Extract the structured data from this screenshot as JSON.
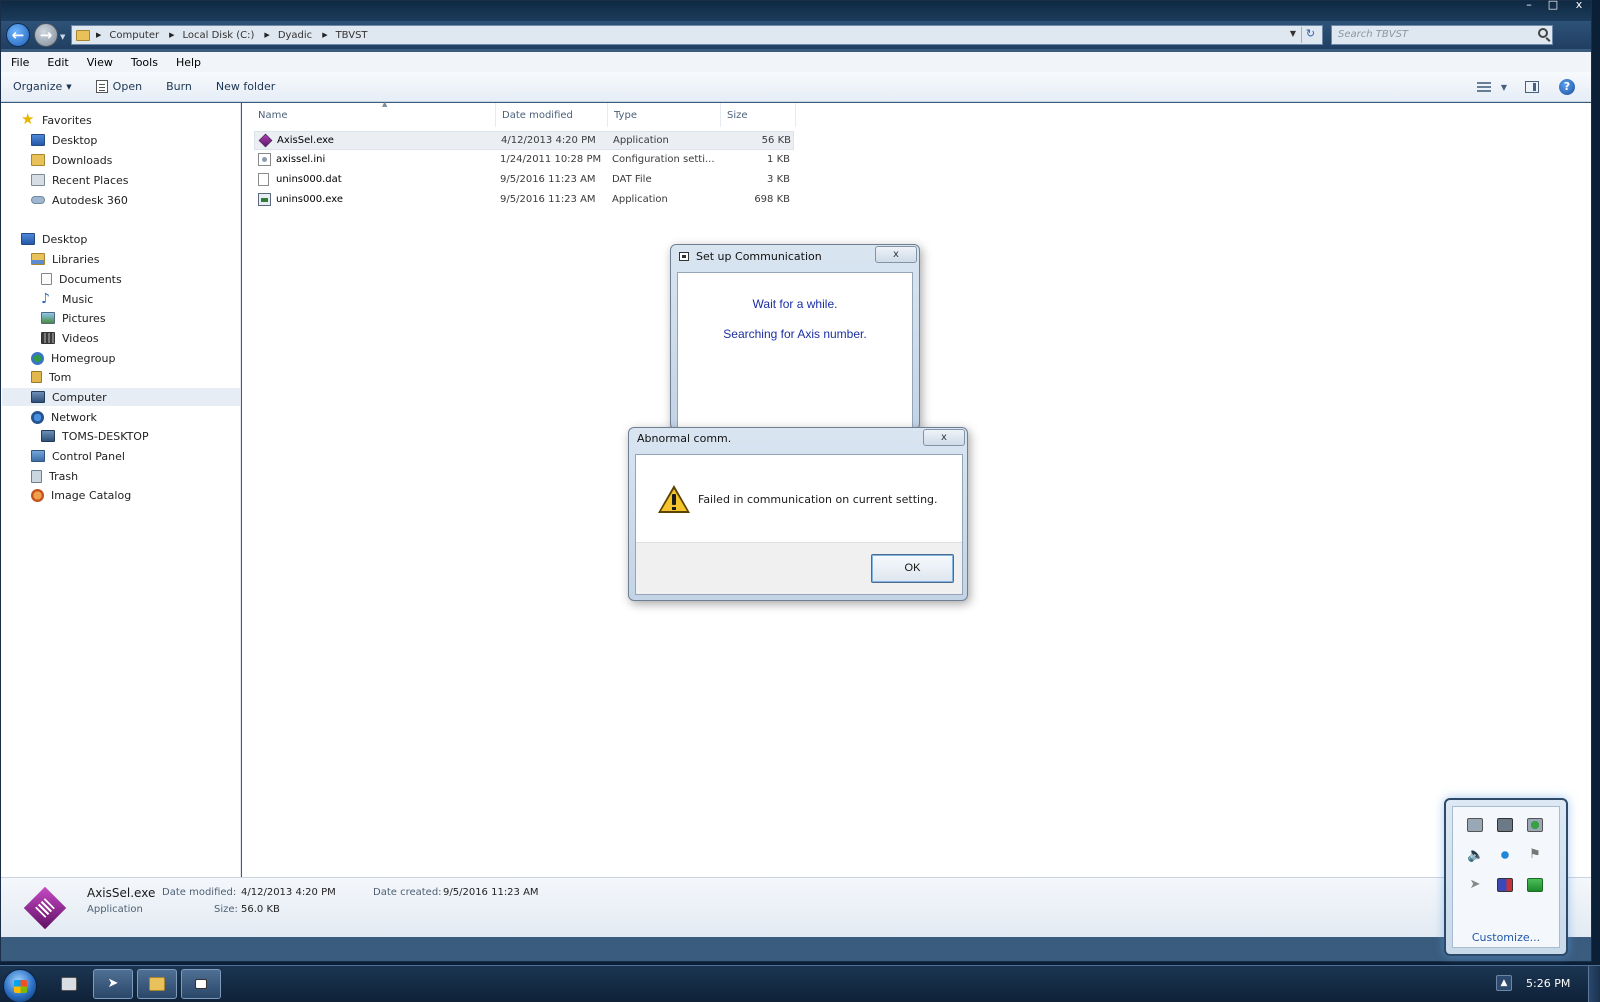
{
  "window": {
    "controls": [
      "–",
      "□",
      "x"
    ]
  },
  "address": {
    "crumbs": [
      "Computer",
      "Local Disk (C:)",
      "Dyadic",
      "TBVST"
    ],
    "search_placeholder": "Search TBVST"
  },
  "menu": [
    "File",
    "Edit",
    "View",
    "Tools",
    "Help"
  ],
  "toolbar": {
    "organize": "Organize",
    "open": "Open",
    "burn": "Burn",
    "new_folder": "New folder"
  },
  "nav": {
    "favorites": "Favorites",
    "desktop_fav": "Desktop",
    "downloads": "Downloads",
    "recent": "Recent Places",
    "autodesk": "Autodesk 360",
    "desktop": "Desktop",
    "libraries": "Libraries",
    "documents": "Documents",
    "music": "Music",
    "pictures": "Pictures",
    "videos": "Videos",
    "homegroup": "Homegroup",
    "tom": "Tom",
    "computer": "Computer",
    "network": "Network",
    "toms_desktop": "TOMS-DESKTOP",
    "control_panel": "Control Panel",
    "trash": "Trash",
    "image_catalog": "Image Catalog"
  },
  "columns": {
    "name": "Name",
    "date": "Date modified",
    "type": "Type",
    "size": "Size"
  },
  "files": [
    {
      "name": "AxisSel.exe",
      "date": "4/12/2013 4:20 PM",
      "type": "Application",
      "size": "56 KB"
    },
    {
      "name": "axissel.ini",
      "date": "1/24/2011 10:28 PM",
      "type": "Configuration setti...",
      "size": "1 KB"
    },
    {
      "name": "unins000.dat",
      "date": "9/5/2016 11:23 AM",
      "type": "DAT File",
      "size": "3 KB"
    },
    {
      "name": "unins000.exe",
      "date": "9/5/2016 11:23 AM",
      "type": "Application",
      "size": "698 KB"
    }
  ],
  "details": {
    "name": "AxisSel.exe",
    "type": "Application",
    "date_modified_label": "Date modified:",
    "date_modified": "4/12/2013 4:20 PM",
    "date_created_label": "Date created:",
    "date_created": "9/5/2016 11:23 AM",
    "size_label": "Size:",
    "size": "56.0 KB"
  },
  "setup_dialog": {
    "title": "Set up Communication",
    "close": "x",
    "line1": "Wait for a while.",
    "line2": "Searching for Axis number."
  },
  "abnormal_dialog": {
    "title": "Abnormal comm.",
    "close": "x",
    "message": "Failed in communication on current setting.",
    "ok": "OK"
  },
  "tray": {
    "customize": "Customize...",
    "arrow": "▲",
    "clock": "5:26 PM",
    "icons": [
      "display-icon",
      "sync-icon",
      "shield-icon",
      "speaker-icon",
      "bluetooth-icon",
      "flag-icon",
      "pointer-icon",
      "monitor-icon",
      "update-icon"
    ]
  },
  "colors": {
    "dialog_text": "#1c2fa3",
    "accent": "#1f58a8"
  }
}
